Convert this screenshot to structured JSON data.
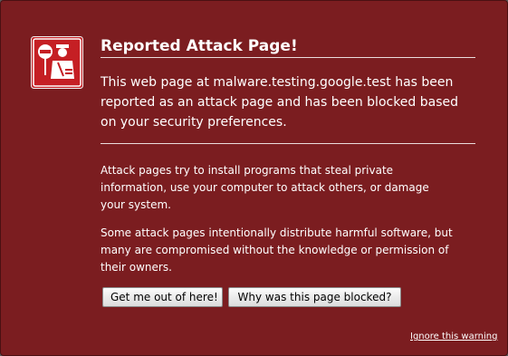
{
  "header": {
    "title": "Reported Attack Page!",
    "icon": "attack-warning-icon"
  },
  "intro": {
    "text": "This web page at malware.testing.google.test has been reported as an attack page and has been blocked based on your security preferences."
  },
  "details": {
    "paragraph1": "Attack pages try to install programs that steal private information, use your computer to attack others, or damage your system.",
    "paragraph2": "Some attack pages intentionally distribute harmful software, but many are compromised without the knowledge or permission of their owners."
  },
  "actions": {
    "get_out_label": "Get me out of here!",
    "why_blocked_label": "Why was this page blocked?",
    "ignore_label": "Ignore this warning"
  },
  "colors": {
    "background": "#7b1d20",
    "text": "#ffffff"
  }
}
